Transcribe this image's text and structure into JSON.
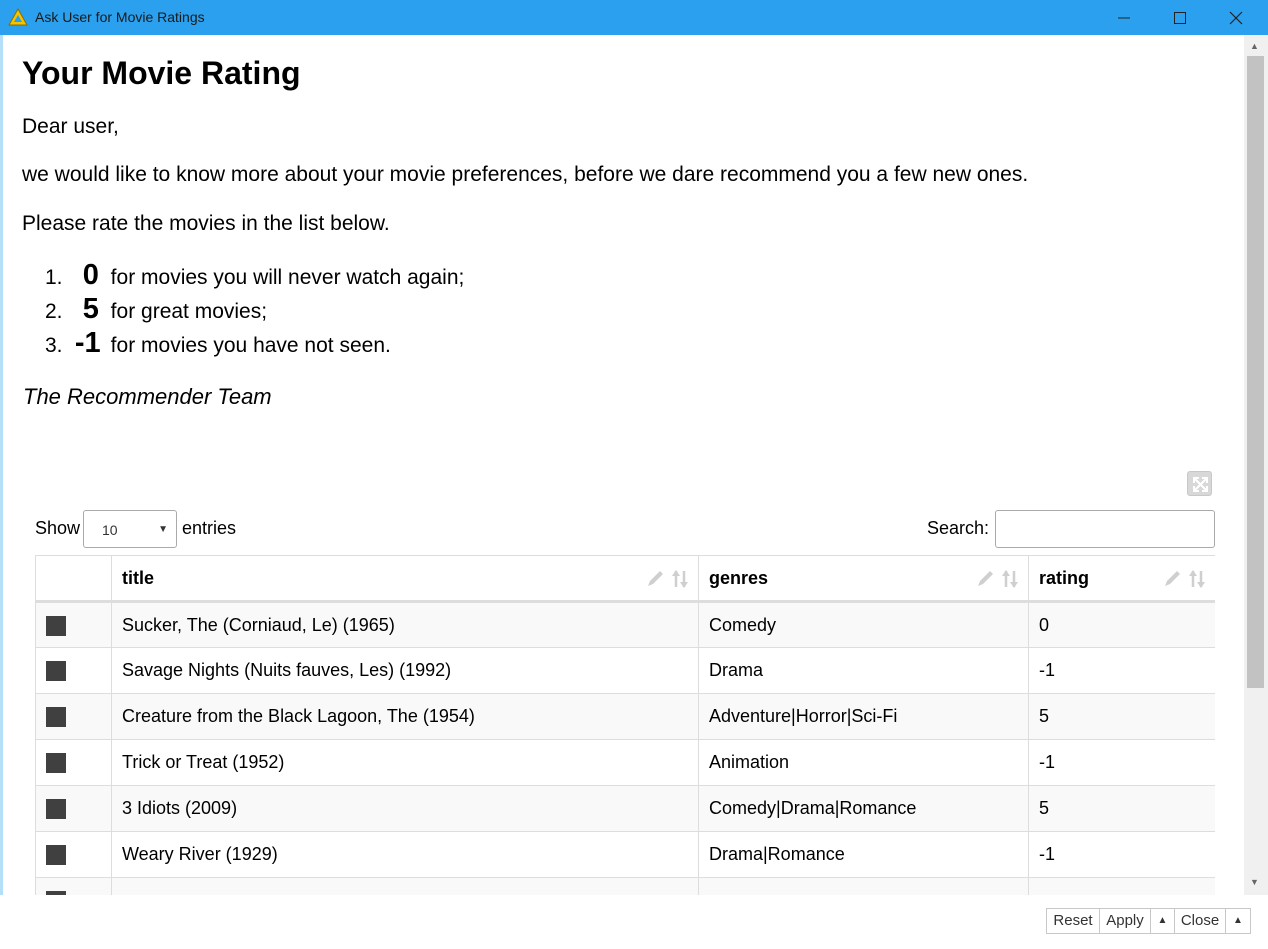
{
  "window": {
    "title": "Ask User for Movie Ratings",
    "accent_color": "#2aa0ee",
    "icon": "knime-triangle-icon"
  },
  "page": {
    "title": "Your Movie Rating",
    "greeting": "Dear user,",
    "intro": "we would like to know more about your movie preferences, before we dare recommend you a few new ones.",
    "instruction": "Please rate the movies in the list below.",
    "rules": [
      {
        "num": "1.",
        "value": "0",
        "text": " for movies you will never watch again;"
      },
      {
        "num": "2.",
        "value": "5",
        "text": " for great movies;"
      },
      {
        "num": "3.",
        "value": "-1",
        "text": " for movies you have not seen."
      }
    ],
    "signature": "The Recommender Team"
  },
  "table_controls": {
    "show_label": "Show",
    "entries_value": "10",
    "entries_label": "entries",
    "search_label": "Search:",
    "search_value": ""
  },
  "table": {
    "columns": [
      "",
      "title",
      "genres",
      "rating"
    ],
    "rows": [
      {
        "title": "Sucker, The (Corniaud, Le) (1965)",
        "genres": "Comedy",
        "rating": "0"
      },
      {
        "title": "Savage Nights (Nuits fauves, Les) (1992)",
        "genres": "Drama",
        "rating": "-1"
      },
      {
        "title": "Creature from the Black Lagoon, The (1954)",
        "genres": "Adventure|Horror|Sci-Fi",
        "rating": "5"
      },
      {
        "title": "Trick or Treat (1952)",
        "genres": "Animation",
        "rating": "-1"
      },
      {
        "title": "3 Idiots (2009)",
        "genres": "Comedy|Drama|Romance",
        "rating": "5"
      },
      {
        "title": "Weary River (1929)",
        "genres": "Drama|Romance",
        "rating": "-1"
      }
    ]
  },
  "footer": {
    "reset": "Reset",
    "apply": "Apply",
    "close": "Close"
  }
}
